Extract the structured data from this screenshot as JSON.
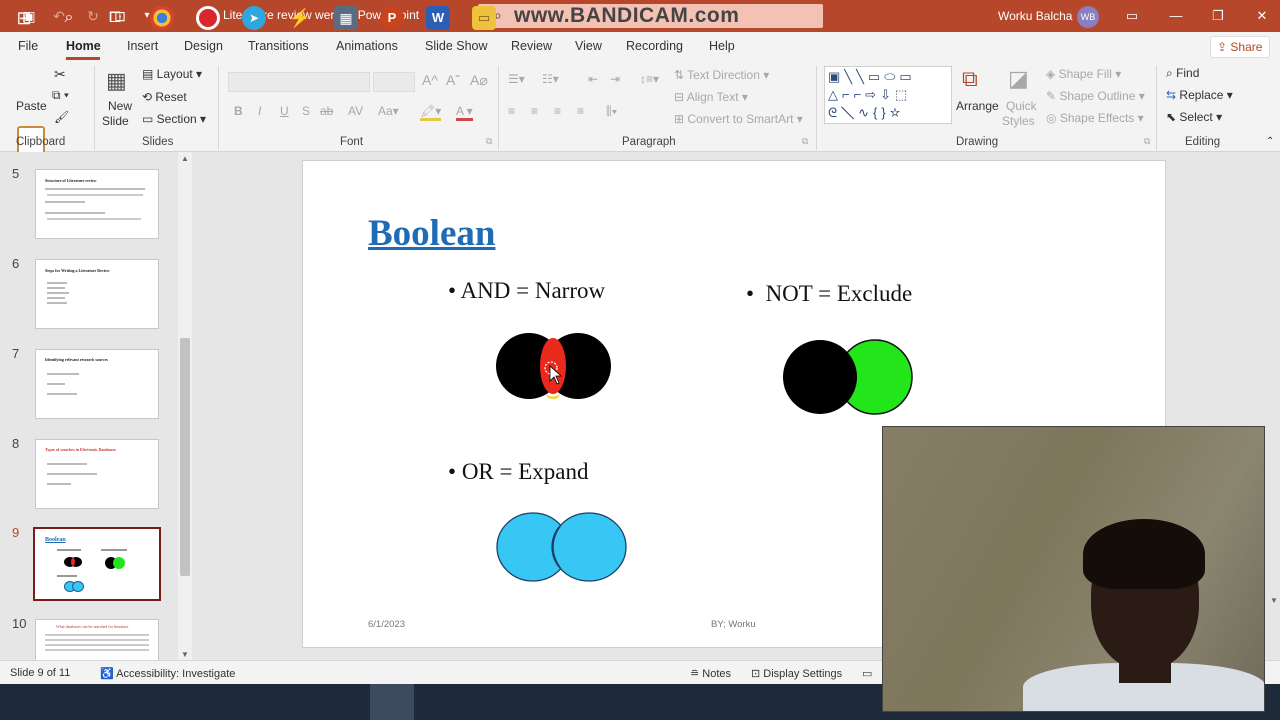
{
  "titlebar": {
    "doc_title": "Literature review werku  -  PowerPoint",
    "watermark": "www.BANDICAM.com",
    "user_name": "Worku Balcha",
    "user_initials": "WB"
  },
  "menu": {
    "tabs": [
      "File",
      "Home",
      "Insert",
      "Design",
      "Transitions",
      "Animations",
      "Slide Show",
      "Review",
      "View",
      "Recording",
      "Help"
    ],
    "share": "Share"
  },
  "ribbon": {
    "clipboard": {
      "paste": "Paste",
      "label": "Clipboard"
    },
    "slides": {
      "new_slide_1": "New",
      "new_slide_2": "Slide",
      "layout": "Layout",
      "reset": "Reset",
      "section": "Section",
      "label": "Slides"
    },
    "font": {
      "label": "Font",
      "bold": "B",
      "italic": "I",
      "underline": "U",
      "strike": "ab",
      "spacing": "AV"
    },
    "paragraph": {
      "text_direction": "Text Direction",
      "align_text": "Align Text",
      "convert": "Convert to SmartArt",
      "label": "Paragraph"
    },
    "drawing": {
      "arrange": "Arrange",
      "quick_styles_1": "Quick",
      "quick_styles_2": "Styles",
      "shape_fill": "Shape Fill",
      "shape_outline": "Shape Outline",
      "shape_effects": "Shape Effects",
      "label": "Drawing"
    },
    "editing": {
      "find": "Find",
      "replace": "Replace",
      "select": "Select",
      "label": "Editing"
    }
  },
  "thumbnails": [
    {
      "num": "5",
      "title": "Structure of Literature review"
    },
    {
      "num": "6",
      "title": "Steps for Writing a Literature Review"
    },
    {
      "num": "7",
      "title": "Identifying relevant research sources"
    },
    {
      "num": "8",
      "title": "Types of searches in Electronic Databases"
    },
    {
      "num": "9",
      "title": "Boolean"
    },
    {
      "num": "10",
      "title": "What databases can be searched for literature"
    }
  ],
  "slide": {
    "title": "Boolean",
    "and_text": "AND = Narrow",
    "not_text": "NOT = Exclude",
    "or_text": "OR = Expand",
    "date": "6/1/2023",
    "author": "BY; Worku"
  },
  "colors": {
    "ppt_red": "#b7472a",
    "title_blue": "#1f6bb5",
    "and_overlap": "#e8291c",
    "not_green": "#22e51a",
    "or_blue": "#38c6f4"
  },
  "status": {
    "slide_count": "Slide 9 of 11",
    "accessibility": "Accessibility: Investigate",
    "notes": "Notes",
    "display": "Display Settings"
  }
}
